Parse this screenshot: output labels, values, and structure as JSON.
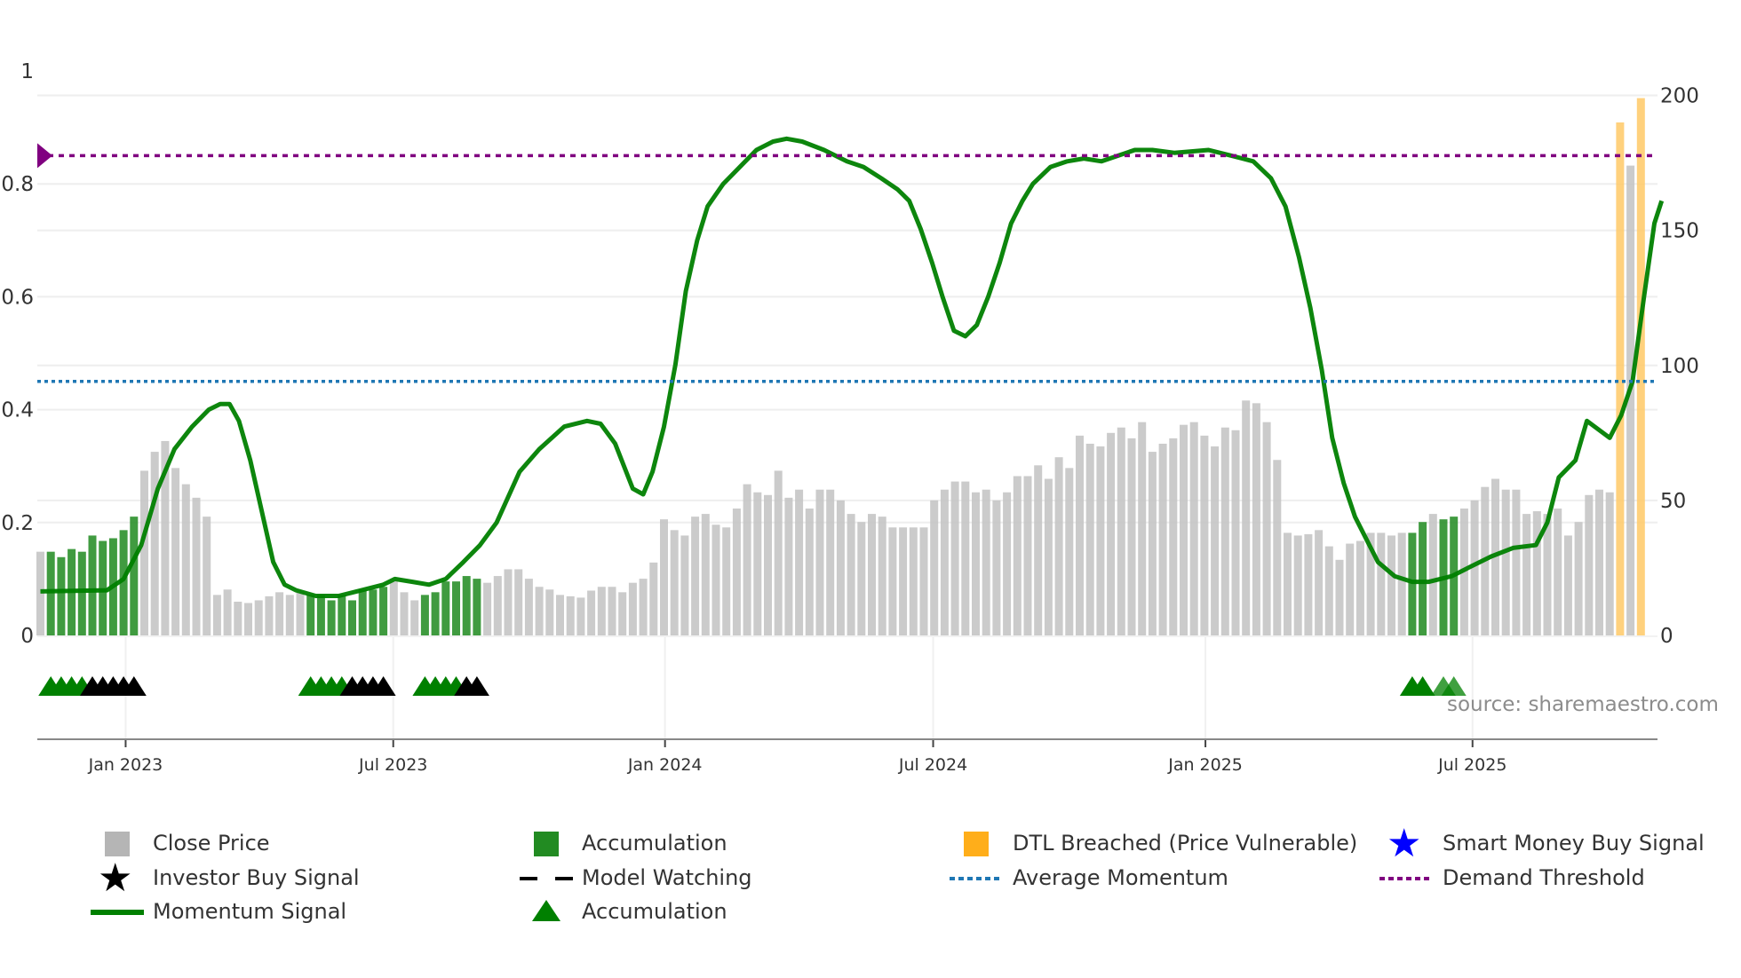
{
  "chart_data": {
    "type": "bar",
    "title": "",
    "x_unit": "weeks since first bar",
    "x_ticks": [
      {
        "label": "Jan 2023",
        "week": 8.2
      },
      {
        "label": "Jul 2023",
        "week": 33.95
      },
      {
        "label": "Jan 2024",
        "week": 60.1
      },
      {
        "label": "Jul 2024",
        "week": 85.9
      },
      {
        "label": "Jan 2025",
        "week": 112.1
      },
      {
        "label": "Jul 2025",
        "week": 137.8
      }
    ],
    "left_axis": {
      "range": [
        0,
        1
      ],
      "ticks": [
        "0",
        "0.2",
        "0.4",
        "0.6",
        "0.8",
        "1"
      ],
      "values": [
        0,
        0.2,
        0.4,
        0.6,
        0.8,
        1
      ]
    },
    "right_axis": {
      "range": [
        0,
        200
      ],
      "ticks": [
        "0",
        "50",
        "100",
        "150",
        "200"
      ],
      "values": [
        0,
        50,
        100,
        150,
        200
      ]
    },
    "close_price": [
      31,
      31,
      29,
      32,
      31,
      37,
      35,
      36,
      39,
      44,
      61,
      68,
      72,
      62,
      56,
      51,
      44,
      15,
      17,
      12.5,
      12,
      13,
      14.5,
      16,
      15,
      16,
      15,
      15,
      13,
      15,
      13,
      17,
      17,
      18,
      20,
      16,
      13,
      15,
      16,
      20,
      20,
      22,
      21,
      19.5,
      22,
      24.5,
      24.5,
      21,
      18,
      17,
      15,
      14.5,
      14,
      16.6,
      18,
      18,
      16,
      19.5,
      21,
      27,
      43,
      39,
      37,
      44,
      45,
      41,
      40,
      47,
      56,
      53,
      52,
      61,
      51,
      54,
      47,
      54,
      54,
      50,
      45,
      42,
      45,
      44,
      40,
      40,
      40,
      40,
      50,
      54,
      57,
      57,
      53,
      54,
      50,
      53,
      59,
      59,
      63,
      58,
      66,
      62,
      74,
      71,
      70,
      75,
      77,
      73,
      79,
      68,
      71,
      73,
      78,
      79,
      74,
      70,
      77,
      76,
      87,
      86,
      79,
      65,
      38,
      37,
      37.5,
      39,
      33,
      28,
      34,
      35,
      38,
      38,
      37,
      38,
      38,
      42,
      45,
      43,
      44,
      47,
      50,
      55,
      58,
      54,
      54,
      45,
      46,
      45,
      47,
      37,
      42,
      52,
      54,
      53,
      190,
      174,
      199
    ],
    "accumulation_bars": [
      1,
      2,
      3,
      4,
      5,
      6,
      7,
      8,
      9,
      26,
      27,
      28,
      29,
      30,
      31,
      32,
      33,
      37,
      38,
      39,
      40,
      41,
      42,
      132,
      133,
      135,
      136
    ],
    "dtl_breached_bars": [
      152,
      154
    ],
    "momentum": [
      [
        0,
        0.078
      ],
      [
        6.4,
        0.08
      ],
      [
        8,
        0.1
      ],
      [
        9.7,
        0.16
      ],
      [
        11.3,
        0.26
      ],
      [
        12.9,
        0.33
      ],
      [
        14.6,
        0.37
      ],
      [
        16.2,
        0.4
      ],
      [
        17.3,
        0.41
      ],
      [
        18.2,
        0.41
      ],
      [
        19.1,
        0.38
      ],
      [
        20.2,
        0.31
      ],
      [
        21.3,
        0.22
      ],
      [
        22.4,
        0.13
      ],
      [
        23.5,
        0.09
      ],
      [
        24.6,
        0.08
      ],
      [
        26.5,
        0.07
      ],
      [
        28.7,
        0.07
      ],
      [
        30.9,
        0.08
      ],
      [
        33,
        0.09
      ],
      [
        34.1,
        0.1
      ],
      [
        35.8,
        0.095
      ],
      [
        37.4,
        0.09
      ],
      [
        39,
        0.1
      ],
      [
        40.7,
        0.13
      ],
      [
        42.3,
        0.16
      ],
      [
        43.9,
        0.2
      ],
      [
        46.1,
        0.29
      ],
      [
        48,
        0.33
      ],
      [
        50.4,
        0.37
      ],
      [
        52.6,
        0.38
      ],
      [
        53.9,
        0.375
      ],
      [
        55.3,
        0.34
      ],
      [
        57,
        0.26
      ],
      [
        58,
        0.25
      ],
      [
        58.9,
        0.29
      ],
      [
        60,
        0.37
      ],
      [
        61.1,
        0.48
      ],
      [
        62.1,
        0.61
      ],
      [
        63.2,
        0.7
      ],
      [
        64.2,
        0.76
      ],
      [
        65.7,
        0.8
      ],
      [
        67.3,
        0.83
      ],
      [
        68.9,
        0.86
      ],
      [
        70.5,
        0.875
      ],
      [
        71.8,
        0.88
      ],
      [
        73.3,
        0.875
      ],
      [
        75.4,
        0.86
      ],
      [
        77.6,
        0.84
      ],
      [
        79.2,
        0.83
      ],
      [
        80.9,
        0.81
      ],
      [
        82.5,
        0.79
      ],
      [
        83.6,
        0.77
      ],
      [
        84.7,
        0.72
      ],
      [
        85.8,
        0.66
      ],
      [
        86.8,
        0.6
      ],
      [
        87.9,
        0.54
      ],
      [
        89,
        0.53
      ],
      [
        90.1,
        0.55
      ],
      [
        91.2,
        0.6
      ],
      [
        92.3,
        0.66
      ],
      [
        93.4,
        0.73
      ],
      [
        94.5,
        0.77
      ],
      [
        95.5,
        0.8
      ],
      [
        97.2,
        0.83
      ],
      [
        98.8,
        0.84
      ],
      [
        100.4,
        0.845
      ],
      [
        102.1,
        0.84
      ],
      [
        103.7,
        0.85
      ],
      [
        105.3,
        0.86
      ],
      [
        107,
        0.86
      ],
      [
        109.1,
        0.855
      ],
      [
        112.4,
        0.86
      ],
      [
        114.6,
        0.85
      ],
      [
        116.7,
        0.84
      ],
      [
        118.4,
        0.81
      ],
      [
        119.8,
        0.76
      ],
      [
        121.1,
        0.67
      ],
      [
        122.2,
        0.58
      ],
      [
        123.3,
        0.47
      ],
      [
        124.3,
        0.35
      ],
      [
        125.4,
        0.27
      ],
      [
        126.5,
        0.21
      ],
      [
        127.6,
        0.17
      ],
      [
        128.7,
        0.13
      ],
      [
        130.3,
        0.105
      ],
      [
        132,
        0.095
      ],
      [
        133.6,
        0.095
      ],
      [
        135.8,
        0.105
      ],
      [
        137.4,
        0.12
      ],
      [
        139.6,
        0.14
      ],
      [
        141.7,
        0.155
      ],
      [
        143.9,
        0.16
      ],
      [
        145,
        0.2
      ],
      [
        146.1,
        0.28
      ],
      [
        147.7,
        0.31
      ],
      [
        148.8,
        0.38
      ],
      [
        151,
        0.35
      ],
      [
        152.1,
        0.39
      ],
      [
        153.2,
        0.45
      ],
      [
        154.3,
        0.6
      ],
      [
        155.3,
        0.73
      ],
      [
        156,
        0.77
      ]
    ],
    "average_momentum": 0.45,
    "demand_threshold": 0.85,
    "accumulation_markers": [
      1,
      2,
      3,
      4,
      26,
      27,
      28,
      29,
      37,
      38,
      39,
      40,
      132,
      133,
      135,
      136
    ],
    "faded_markers": [
      135,
      136
    ],
    "investor_markers": [
      5,
      6,
      7,
      8,
      9,
      30,
      31,
      32,
      33,
      41,
      42
    ],
    "annotation": "source: sharemaestro.com",
    "legend": [
      {
        "label": "Close Price",
        "color": "#b5b5b5",
        "symbol": "square"
      },
      {
        "label": "Accumulation",
        "color": "#228b22",
        "symbol": "square"
      },
      {
        "label": "DTL Breached (Price Vulnerable)",
        "color": "#ffae1a",
        "symbol": "square"
      },
      {
        "label": "Smart Money Buy Signal",
        "color": "#0000ff",
        "symbol": "star"
      },
      {
        "label": "Investor Buy Signal",
        "color": "#000000",
        "symbol": "star"
      },
      {
        "label": "Model Watching",
        "color": "#000000",
        "symbol": "dash"
      },
      {
        "label": "Average Momentum",
        "color": "#1f77b4",
        "symbol": "dot"
      },
      {
        "label": "Demand Threshold",
        "color": "#800080",
        "symbol": "dot"
      },
      {
        "label": "Momentum Signal",
        "color": "#008000",
        "symbol": "line"
      },
      {
        "label": "Accumulation",
        "color": "#008000",
        "symbol": "triangle"
      }
    ],
    "legend_placement": "bottom"
  }
}
